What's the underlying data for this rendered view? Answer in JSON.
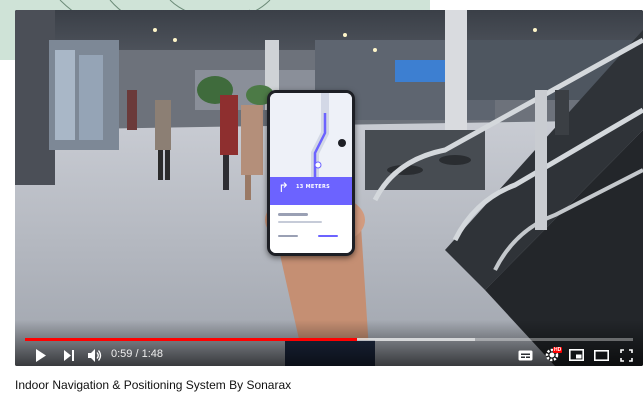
{
  "video": {
    "title": "Indoor Navigation & Positioning System By Sonarax",
    "time_display": "0:59 / 1:48",
    "progress_played": 0.546,
    "progress_loaded": 0.74
  },
  "phone_screen": {
    "distance_label": "13 METERS"
  },
  "controls": {
    "hd_badge": "HD",
    "icons": [
      "play-icon",
      "next-icon",
      "volume-icon",
      "subtitles-icon",
      "settings-icon",
      "miniplayer-icon",
      "theater-icon",
      "fullscreen-icon"
    ]
  },
  "colors": {
    "progress": "#ff0000",
    "accent_phone": "#6c63ff"
  }
}
